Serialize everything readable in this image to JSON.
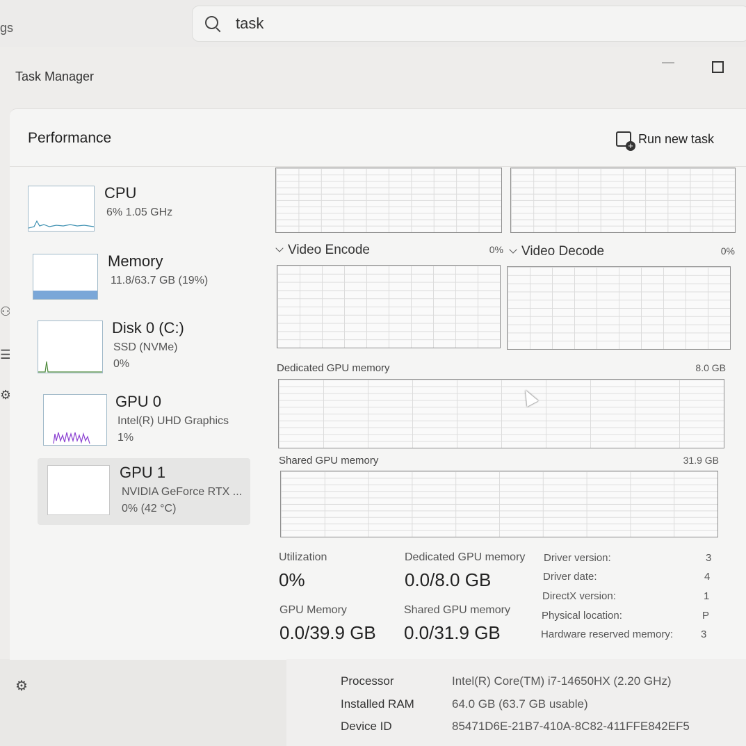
{
  "background": {
    "left_fragment": "gs",
    "search": {
      "value": "task"
    }
  },
  "window": {
    "title": "Task Manager",
    "header": "Performance",
    "run_new_task": "Run new task"
  },
  "devices": [
    {
      "name": "CPU",
      "sub": "6% 1.05 GHz",
      "sub2": ""
    },
    {
      "name": "Memory",
      "sub": "11.8/63.7 GB (19%)",
      "sub2": ""
    },
    {
      "name": "Disk 0 (C:)",
      "sub": "SSD (NVMe)",
      "sub2": "0%"
    },
    {
      "name": "GPU 0",
      "sub": "Intel(R) UHD Graphics",
      "sub2": "1%"
    },
    {
      "name": "GPU 1",
      "sub": "NVIDIA GeForce RTX ...",
      "sub2": "0% (42 °C)"
    }
  ],
  "engines": {
    "encode": {
      "label": "Video Encode",
      "value": "0%"
    },
    "decode": {
      "label": "Video Decode",
      "value": "0%"
    }
  },
  "memory_graphs": {
    "dedicated": {
      "label": "Dedicated GPU memory",
      "max": "8.0 GB"
    },
    "shared": {
      "label": "Shared GPU memory",
      "max": "31.9 GB"
    }
  },
  "stats": {
    "utilization": {
      "label": "Utilization",
      "value": "0%"
    },
    "dedicated": {
      "label": "Dedicated GPU memory",
      "value": "0.0/8.0 GB"
    },
    "gpu_memory": {
      "label": "GPU Memory",
      "value": "0.0/39.9 GB"
    },
    "shared": {
      "label": "Shared GPU memory",
      "value": "0.0/31.9 GB"
    }
  },
  "info": [
    {
      "label": "Driver version:",
      "value": "3"
    },
    {
      "label": "Driver date:",
      "value": "4"
    },
    {
      "label": "DirectX version:",
      "value": "1"
    },
    {
      "label": "Physical location:",
      "value": "P"
    },
    {
      "label": "Hardware reserved memory:",
      "value": "3"
    }
  ],
  "about": [
    {
      "label": "Processor",
      "value": "Intel(R) Core(TM) i7-14650HX (2.20 GHz)"
    },
    {
      "label": "Installed RAM",
      "value": "64.0 GB (63.7 GB usable)"
    },
    {
      "label": "Device ID",
      "value": "85471D6E-21B7-410A-8C82-411FFE842EF5"
    }
  ],
  "colors": {
    "cpu_line": "#3b8fb0",
    "memory_fill": "#7aa7d8",
    "disk_line": "#4d8a3a",
    "gpu0_line": "#8a3fd1"
  }
}
